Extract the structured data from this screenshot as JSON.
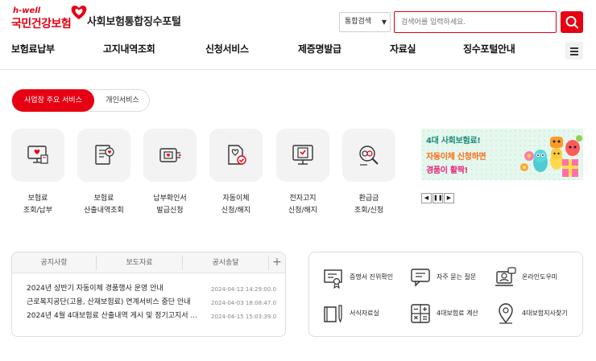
{
  "brand": {
    "slogan": "h-well",
    "name": "국민건강보험",
    "portal_title": "사회보험통합징수포털",
    "accent_color": "#e60012"
  },
  "search": {
    "scope": "통합검색",
    "placeholder": "검색어를 입력하세요.",
    "button_icon": "search-icon"
  },
  "nav": {
    "items": [
      {
        "label": "보험료납부"
      },
      {
        "label": "고지내역조회"
      },
      {
        "label": "신청서비스"
      },
      {
        "label": "제증명발급"
      },
      {
        "label": "자료실"
      },
      {
        "label": "징수포털안내"
      }
    ],
    "menu_icon": "hamburger-menu-icon"
  },
  "service_tabs": {
    "active": "사업장 주요 서비스",
    "inactive": "개인서비스"
  },
  "services": [
    {
      "line1": "보험료",
      "line2": "조회/납부",
      "icon": "computer-invoice-icon"
    },
    {
      "line1": "보험료",
      "line2": "산출내역조회",
      "icon": "document-stack-icon"
    },
    {
      "line1": "납부확인서",
      "line2": "발급신청",
      "icon": "printer-icon"
    },
    {
      "line1": "자동이체",
      "line2": "신청/해지",
      "icon": "document-check-icon"
    },
    {
      "line1": "전자고지",
      "line2": "신청/해지",
      "icon": "monitor-check-icon"
    },
    {
      "line1": "환급금",
      "line2": "조회/신청",
      "icon": "magnifier-coin-icon"
    }
  ],
  "banner": {
    "line1": "4대 사회보험료!",
    "line2": "자동이체 신청하면",
    "line3": "경품이 활짝!",
    "controls": [
      "◀",
      "❚❚",
      "▶"
    ]
  },
  "notice": {
    "tabs": [
      "공지사항",
      "보도자료",
      "공시송달"
    ],
    "more": "+",
    "rows": [
      {
        "title": "2024년 상반기 자동이체 경품행사 운영 안내",
        "date": "2024-04-12 14:29:00.0"
      },
      {
        "title": "근로복지공단(고용, 산재보험료) 연계서비스 중단 안내",
        "date": "2024-04-03 18:08:47.0"
      },
      {
        "title": "2024년 4월 4대보험료 산출내역 게시 및 정기고지서 ...",
        "date": "2024-04-15 15:03:39.0"
      }
    ]
  },
  "shortcuts": [
    {
      "label": "증명서 진위확인",
      "icon": "certificate-icon"
    },
    {
      "label": "자주 묻는 질문",
      "icon": "chat-bubble-icon"
    },
    {
      "label": "온라인도우미",
      "icon": "online-helper-icon"
    },
    {
      "label": "서식자료실",
      "icon": "book-pen-icon"
    },
    {
      "label": "4대보험료 계산",
      "icon": "calculator-icon"
    },
    {
      "label": "4대보험지사찾기",
      "icon": "location-pin-icon"
    }
  ]
}
